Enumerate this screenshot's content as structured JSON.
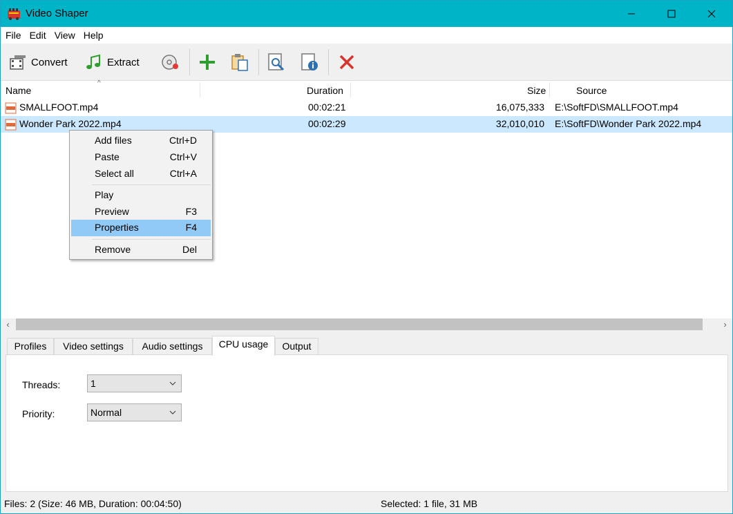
{
  "window": {
    "title": "Video Shaper",
    "accent_color": "#00b4c8"
  },
  "menu": {
    "items": [
      "File",
      "Edit",
      "View",
      "Help"
    ]
  },
  "toolbar": {
    "convert_label": "Convert",
    "extract_label": "Extract",
    "icons": [
      "convert-icon",
      "extract-icon",
      "disc-record-icon",
      "add-icon",
      "paste-icon",
      "preview-icon",
      "properties-icon",
      "remove-icon"
    ]
  },
  "list": {
    "columns": {
      "name": "Name",
      "duration": "Duration",
      "size": "Size",
      "source": "Source"
    },
    "rows": [
      {
        "name": "SMALLFOOT.mp4",
        "duration": "00:02:21",
        "size": "16,075,333",
        "source": "E:\\SoftFD\\SMALLFOOT.mp4",
        "selected": false
      },
      {
        "name": "Wonder Park 2022.mp4",
        "duration": "00:02:29",
        "size": "32,010,010",
        "source": "E:\\SoftFD\\Wonder Park 2022.mp4",
        "selected": true
      }
    ],
    "selection_color": "#cce8ff"
  },
  "context_menu": {
    "items": [
      {
        "label": "Add files",
        "shortcut": "Ctrl+D"
      },
      {
        "label": "Paste",
        "shortcut": "Ctrl+V"
      },
      {
        "label": "Select all",
        "shortcut": "Ctrl+A"
      },
      {
        "label": "Play",
        "shortcut": ""
      },
      {
        "label": "Preview",
        "shortcut": "F3"
      },
      {
        "label": "Properties",
        "shortcut": "F4",
        "highlighted": true
      },
      {
        "label": "Remove",
        "shortcut": "Del"
      }
    ],
    "highlight_color": "#91c9f7"
  },
  "tabs": {
    "items": [
      "Profiles",
      "Video settings",
      "Audio settings",
      "CPU usage",
      "Output"
    ],
    "active": "CPU usage"
  },
  "cpu_usage": {
    "threads_label": "Threads:",
    "threads_value": "1",
    "priority_label": "Priority:",
    "priority_value": "Normal"
  },
  "status": {
    "left": "Files: 2 (Size: 46 MB, Duration: 00:04:50)",
    "right": "Selected: 1 file, 31 MB"
  }
}
